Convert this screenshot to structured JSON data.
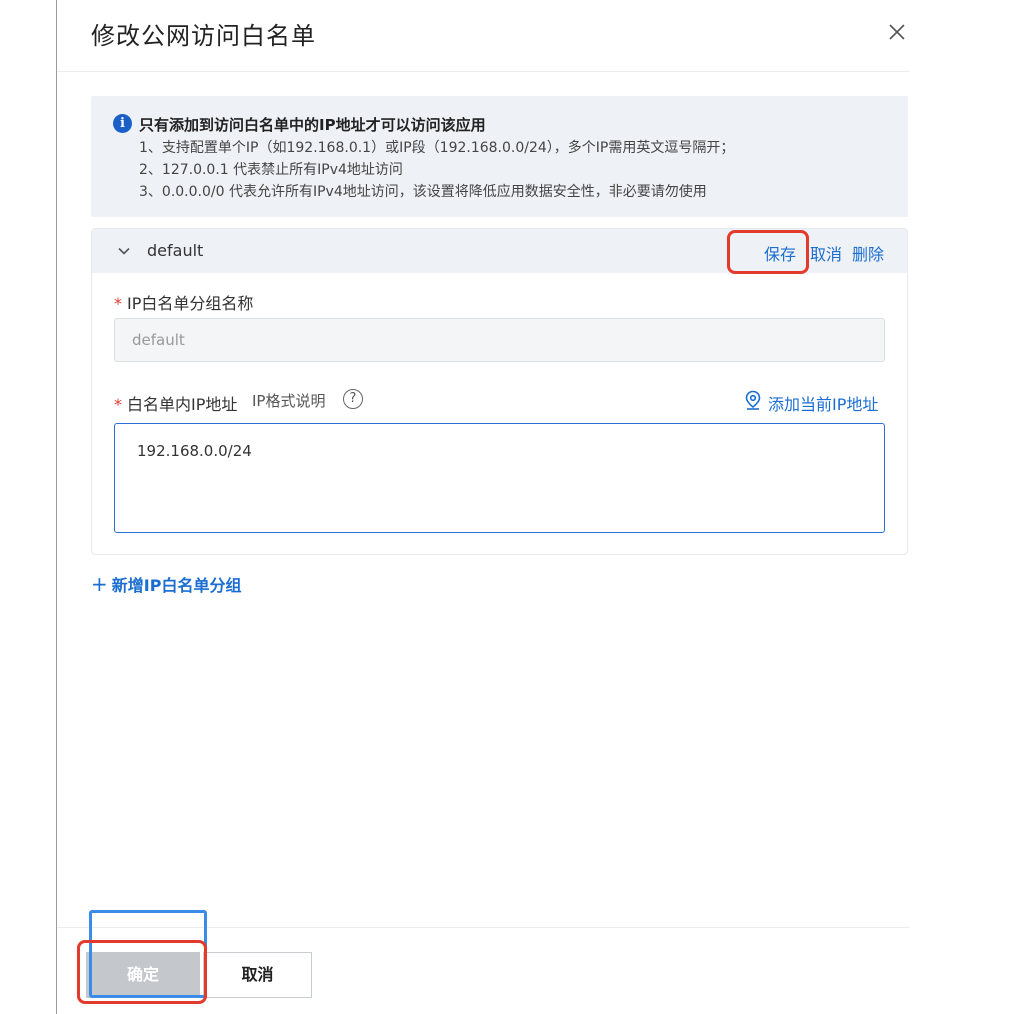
{
  "dialog": {
    "title": "修改公网访问白名单"
  },
  "notice": {
    "title": "只有添加到访问白名单中的IP地址才可以访问该应用",
    "lines": [
      "1、支持配置单个IP（如192.168.0.1）或IP段（192.168.0.0/24），多个IP需用英文逗号隔开；",
      "2、127.0.0.1 代表禁止所有IPv4地址访问",
      "3、0.0.0.0/0 代表允许所有IPv4地址访问，该设置将降低应用数据安全性，非必要请勿使用"
    ]
  },
  "group": {
    "name": "default",
    "actions": {
      "save": "保存",
      "cancel": "取消",
      "delete": "删除"
    },
    "name_field": {
      "label": "IP白名单分组名称",
      "value": "default"
    },
    "ip_field": {
      "label": "白名单内IP地址",
      "help": "IP格式说明",
      "add_current": "添加当前IP地址",
      "value": "192.168.0.0/24"
    }
  },
  "add_group": "新增IP白名单分组",
  "footer": {
    "ok": "确定",
    "cancel": "取消"
  },
  "colors": {
    "accent": "#1b6ed1",
    "required_star": "#e23b2e",
    "highlight_red": "#e23b2e",
    "highlight_blue": "#3b8be8"
  },
  "icons": {
    "close": "close-icon",
    "info": "info-icon",
    "chevron": "chevron-down-icon",
    "help": "question-circle-icon",
    "location": "location-pin-icon",
    "plus": "plus-icon"
  }
}
